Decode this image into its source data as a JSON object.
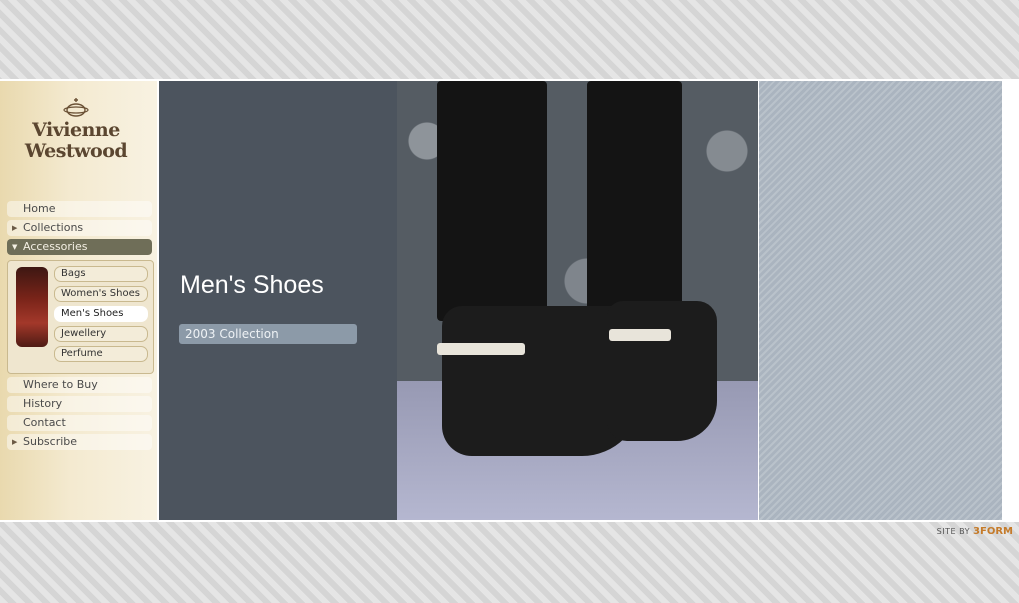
{
  "brand": {
    "line1": "Vivienne",
    "line2": "Westwood"
  },
  "nav_top": [
    {
      "label": "Home",
      "has_caret": false
    },
    {
      "label": "Collections",
      "has_caret": true
    },
    {
      "label": "Accessories",
      "has_caret": true,
      "active": true
    }
  ],
  "accessories_sub": [
    {
      "label": "Bags"
    },
    {
      "label": "Women's Shoes"
    },
    {
      "label": "Men's Shoes",
      "selected": true
    },
    {
      "label": "Jewellery"
    },
    {
      "label": "Perfume"
    }
  ],
  "nav_bottom": [
    {
      "label": "Where to Buy",
      "has_caret": false
    },
    {
      "label": "History",
      "has_caret": false
    },
    {
      "label": "Contact",
      "has_caret": false
    },
    {
      "label": "Subscribe",
      "has_caret": true
    }
  ],
  "main": {
    "title": "Men's Shoes",
    "collection_button": "2003 Collection"
  },
  "credit": {
    "prefix": "SITE BY",
    "company": "3FORM"
  },
  "colors": {
    "main_panel": "#4c545e",
    "active_nav": "#6f6e58",
    "collection_button": "#8c9aa8",
    "right_panel": "#aab4bf",
    "brand_text": "#5b4630",
    "credit_accent": "#c57b2a"
  },
  "icons": {
    "caret_right": "caret-right-icon",
    "caret_down": "caret-down-icon",
    "logo_orb": "orb-logo-icon"
  }
}
